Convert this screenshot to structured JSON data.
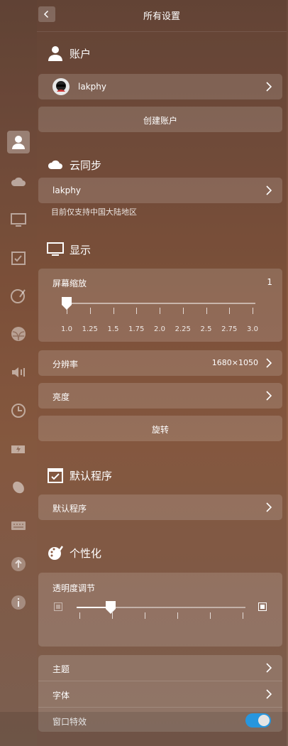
{
  "header": {
    "title": "所有设置"
  },
  "sidebar": {
    "icons": [
      "accounts-icon",
      "cloud-icon",
      "display-icon",
      "default-apps-icon",
      "personalization-icon",
      "network-icon",
      "sound-icon",
      "time-icon",
      "power-icon",
      "mouse-icon",
      "keyboard-icon",
      "update-icon",
      "info-icon"
    ],
    "active": "accounts-icon"
  },
  "accounts": {
    "heading": "账户",
    "user_name": "lakphy",
    "create_button": "创建账户"
  },
  "cloud_sync": {
    "heading": "云同步",
    "account": "lakphy",
    "note": "目前仅支持中国大陆地区"
  },
  "display": {
    "heading": "显示",
    "scale_label": "屏幕缩放",
    "scale_value": "1",
    "scale_ticks": [
      "1.0",
      "1.25",
      "1.5",
      "1.75",
      "2.0",
      "2.25",
      "2.5",
      "2.75",
      "3.0"
    ],
    "scale_position": 0,
    "resolution_label": "分辨率",
    "resolution_value": "1680×1050",
    "brightness_label": "亮度",
    "rotate_button": "旋转"
  },
  "default_apps": {
    "heading": "默认程序",
    "item": "默认程序"
  },
  "personalization": {
    "heading": "个性化",
    "opacity_label": "透明度调节",
    "opacity_level": 0.2,
    "theme_label": "主题",
    "font_label": "字体",
    "effects_label": "窗口特效",
    "effects_on": true
  }
}
